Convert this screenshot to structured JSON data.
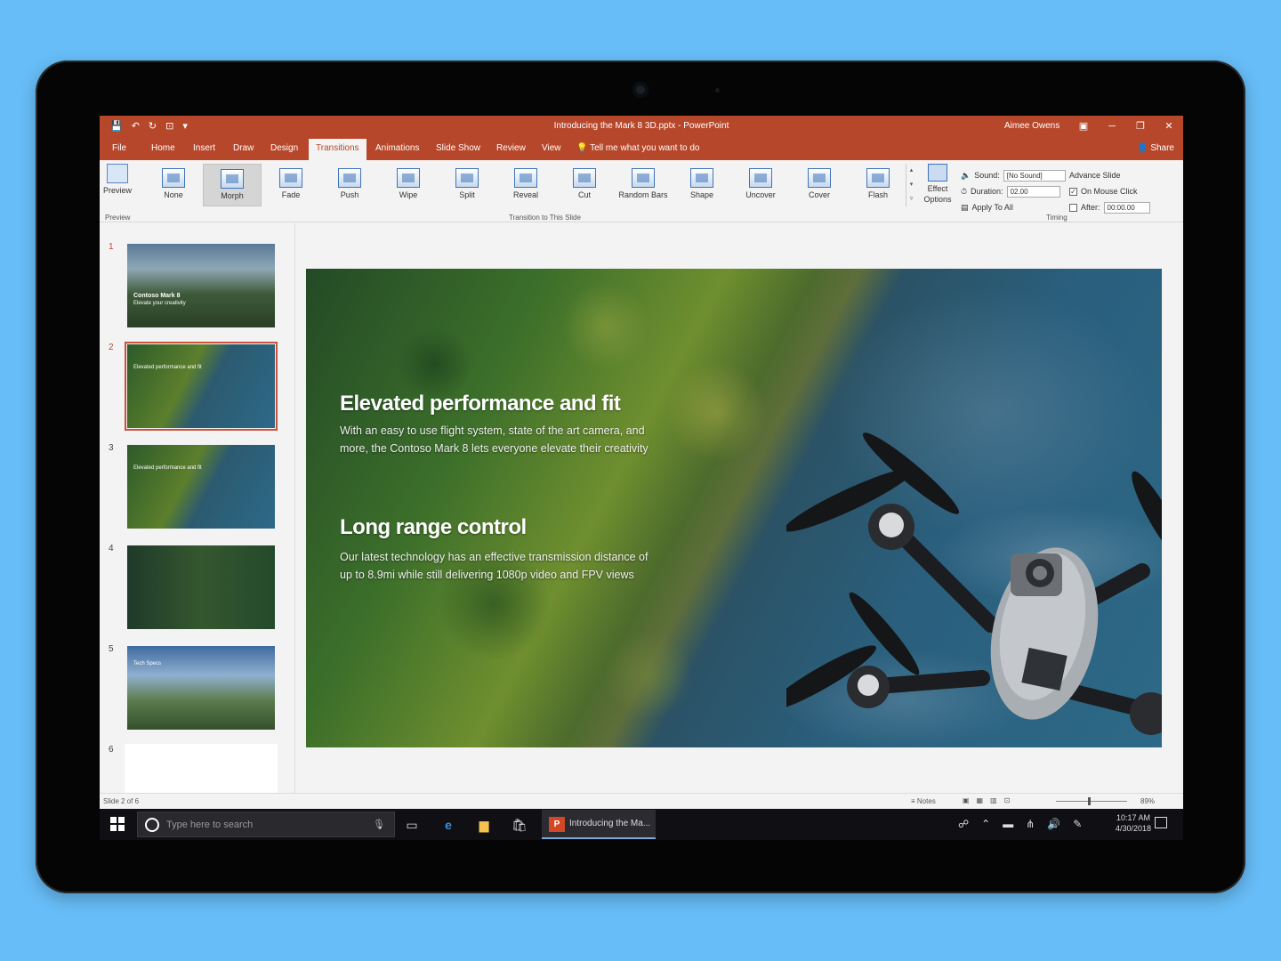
{
  "window": {
    "title": "Introducing the Mark 8 3D.pptx  -  PowerPoint",
    "user": "Aimee Owens",
    "controls": [
      "▣",
      "─",
      "❐",
      "✕"
    ]
  },
  "qat": [
    "💾",
    "↶",
    "↻",
    "⊡",
    "▾"
  ],
  "tabs": [
    {
      "label": "File"
    },
    {
      "label": "Home"
    },
    {
      "label": "Insert"
    },
    {
      "label": "Draw"
    },
    {
      "label": "Design"
    },
    {
      "label": "Transitions"
    },
    {
      "label": "Animations"
    },
    {
      "label": "Slide Show"
    },
    {
      "label": "Review"
    },
    {
      "label": "View"
    }
  ],
  "tellme": "Tell me what you want to do",
  "share": "Share",
  "ribbon": {
    "preview_label": "Preview",
    "preview_group": "Preview",
    "transitions_group": "Transition to This Slide",
    "timing_group": "Timing",
    "effect_options": "Effect Options",
    "transitions": [
      "None",
      "Morph",
      "Fade",
      "Push",
      "Wipe",
      "Split",
      "Reveal",
      "Cut",
      "Random Bars",
      "Shape",
      "Uncover",
      "Cover",
      "Flash"
    ],
    "selected_transition": "Morph",
    "sound_label": "Sound:",
    "sound_value": "[No Sound]",
    "duration_label": "Duration:",
    "duration_value": "02.00",
    "apply_all": "Apply To All",
    "advance_label": "Advance Slide",
    "on_click_label": "On Mouse Click",
    "on_click_checked": true,
    "after_label": "After:",
    "after_value": "00:00.00"
  },
  "thumbnails": [
    {
      "num": "1",
      "text": "Contoso Mark 8",
      "sub": "Elevate your creativity"
    },
    {
      "num": "2",
      "text": "Elevated performance and fit",
      "sub": ""
    },
    {
      "num": "3",
      "text": "Elevated performance and fit",
      "sub": ""
    },
    {
      "num": "4",
      "text": "",
      "sub": ""
    },
    {
      "num": "5",
      "text": "Tech Specs",
      "sub": ""
    },
    {
      "num": "6",
      "text": "",
      "sub": ""
    }
  ],
  "selected_slide": 2,
  "slide": {
    "heading1": "Elevated performance and fit",
    "body1_line1": "With an easy to use flight system, state of the art camera, and",
    "body1_line2": "more, the Contoso Mark 8 lets everyone elevate their creativity",
    "heading2": "Long range control",
    "body2_line1": "Our latest technology has an effective transmission distance of",
    "body2_line2": "up to 8.9mi while still delivering 1080p video and FPV views"
  },
  "status": {
    "slide_counter": "Slide 2 of 6",
    "notes": "Notes",
    "zoom": "89%"
  },
  "taskbar": {
    "search_placeholder": "Type here to search",
    "app_label": "Introducing the Ma...",
    "time": "10:17 AM",
    "date": "4/30/2018"
  },
  "colors": {
    "accent": "#b7472a",
    "background": "#67bdf7"
  }
}
